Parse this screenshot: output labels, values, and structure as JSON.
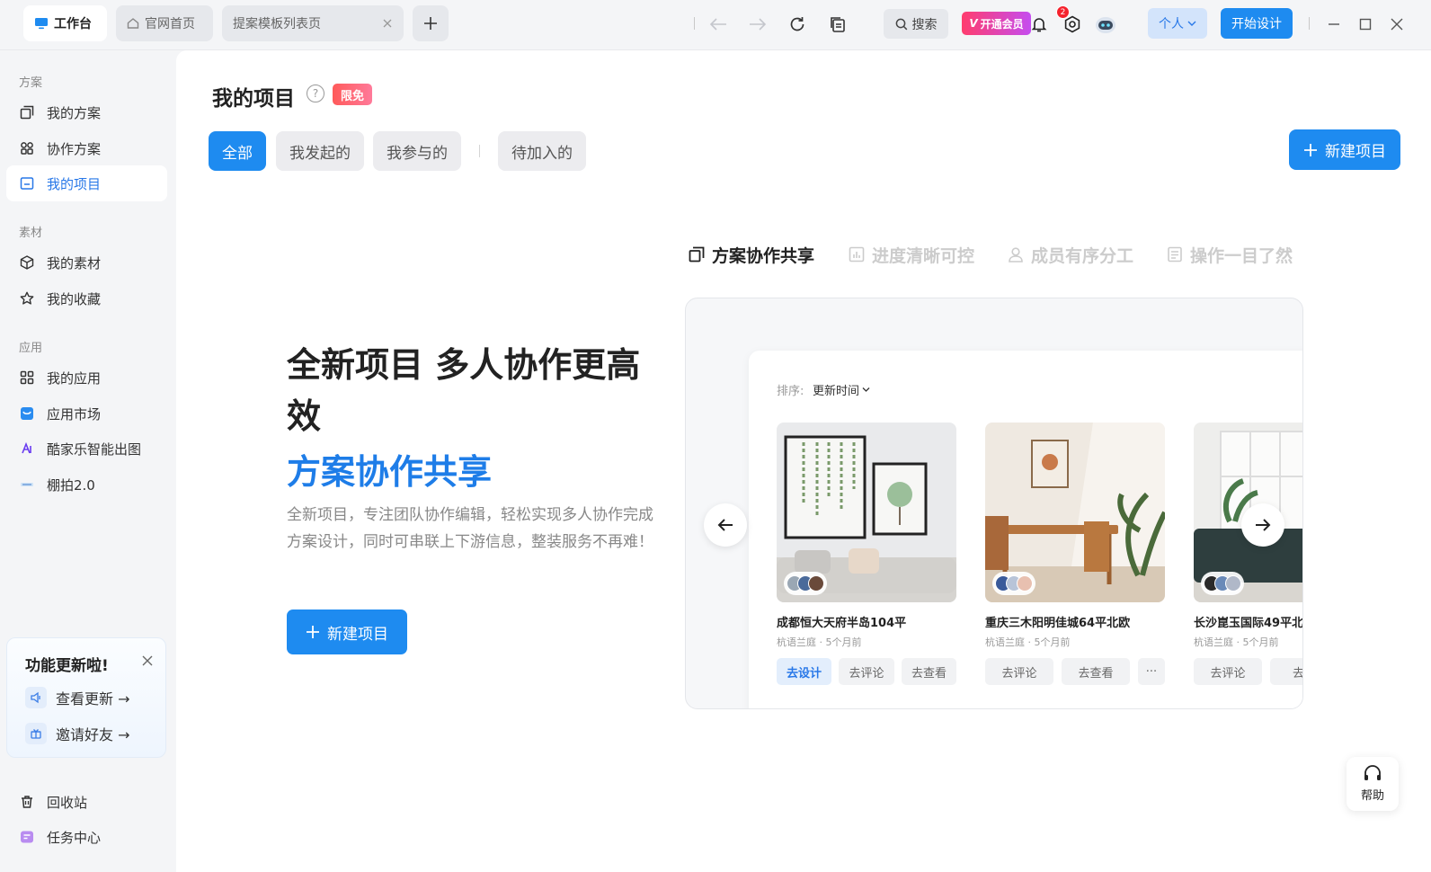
{
  "topbar": {
    "tabs": [
      {
        "label": "工作台",
        "active": true
      },
      {
        "label": "官网首页",
        "active": false
      },
      {
        "label": "提案模板列表页",
        "active": false
      }
    ],
    "search_label": "搜索",
    "vip_label": "开通会员",
    "vip_mark": "V",
    "notification_count": "2",
    "account_label": "个人",
    "start_design_label": "开始设计"
  },
  "sidebar": {
    "sections": [
      {
        "title": "方案",
        "items": [
          {
            "label": "我的方案",
            "icon": "copy-icon"
          },
          {
            "label": "协作方案",
            "icon": "grid-icon"
          },
          {
            "label": "我的项目",
            "icon": "folder-icon",
            "active": true
          }
        ]
      },
      {
        "title": "素材",
        "items": [
          {
            "label": "我的素材",
            "icon": "cube-icon"
          },
          {
            "label": "我的收藏",
            "icon": "star-icon"
          }
        ]
      },
      {
        "title": "应用",
        "items": [
          {
            "label": "我的应用",
            "icon": "apps-icon"
          },
          {
            "label": "应用市场",
            "icon": "market-icon"
          },
          {
            "label": "酷家乐智能出图",
            "icon": "ai-icon"
          },
          {
            "label": "棚拍2.0",
            "icon": "studio-icon"
          }
        ]
      }
    ],
    "update_card": {
      "title": "功能更新啦!",
      "items": [
        "查看更新 →",
        "邀请好友 →"
      ]
    },
    "bottom": [
      {
        "label": "回收站",
        "icon": "trash-icon"
      },
      {
        "label": "任务中心",
        "icon": "task-icon"
      }
    ]
  },
  "main": {
    "title": "我的项目",
    "badge": "限免",
    "filter_tabs": [
      {
        "label": "全部",
        "active": true
      },
      {
        "label": "我发起的",
        "active": false
      },
      {
        "label": "我参与的",
        "active": false
      },
      {
        "label": "待加入的",
        "active": false
      }
    ],
    "new_project_label": "新建项目",
    "hero": {
      "title": "全新项目 多人协作更高效",
      "subtitle": "方案协作共享",
      "description": "全新项目，专注团队协作编辑，轻松实现多人协作完成方案设计，同时可串联上下游信息，整装服务不再难！",
      "button": "新建项目"
    },
    "features": [
      {
        "label": "方案协作共享",
        "active": true
      },
      {
        "label": "进度清晰可控",
        "active": false
      },
      {
        "label": "成员有序分工",
        "active": false
      },
      {
        "label": "操作一目了然",
        "active": false
      }
    ],
    "preview": {
      "sort_label": "排序:",
      "sort_value": "更新时间",
      "cards": [
        {
          "name": "成都恒大天府半岛104平",
          "meta": "杭语兰庭 · 5个月前",
          "buttons": [
            "去设计",
            "去评论",
            "去查看"
          ]
        },
        {
          "name": "重庆三木阳明佳城64平北欧",
          "meta": "杭语兰庭 · 5个月前",
          "buttons": [
            "去评论",
            "去查看",
            "···"
          ]
        },
        {
          "name": "长沙崑玉国际49平北",
          "meta": "杭语兰庭 · 5个月前",
          "buttons": [
            "去评论",
            "去查"
          ]
        }
      ]
    },
    "help_label": "帮助"
  }
}
